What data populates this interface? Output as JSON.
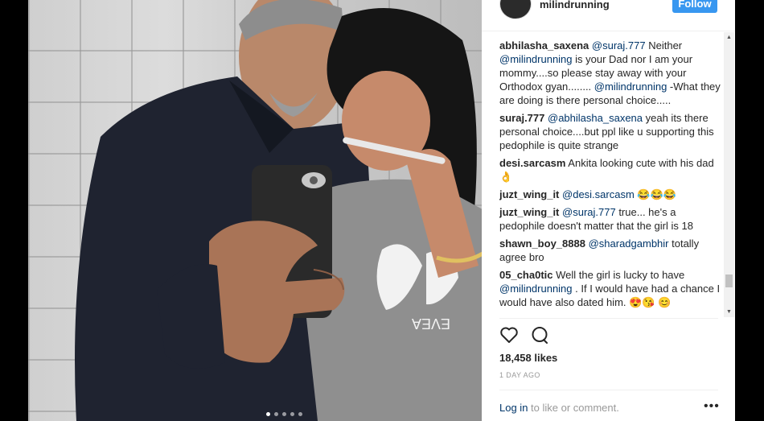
{
  "header": {
    "username": "milindrunning",
    "follow_label": "Follow"
  },
  "comments": [
    {
      "user": "abhilasha_saxena",
      "segments": [
        {
          "t": "mention",
          "v": "@suraj.777"
        },
        {
          "t": "text",
          "v": " Neither "
        },
        {
          "t": "mention",
          "v": "@milindrunning"
        },
        {
          "t": "text",
          "v": " is your Dad nor I am your mommy....so please stay away with your Orthodox gyan........ "
        },
        {
          "t": "mention",
          "v": "@milindrunning"
        },
        {
          "t": "text",
          "v": " -What they are doing is there personal choice....."
        }
      ]
    },
    {
      "user": "suraj.777",
      "segments": [
        {
          "t": "mention",
          "v": "@abhilasha_saxena"
        },
        {
          "t": "text",
          "v": " yeah its there personal choice....but ppl like u supporting this pedophile is quite strange"
        }
      ]
    },
    {
      "user": "desi.sarcasm",
      "segments": [
        {
          "t": "text",
          "v": " Ankita looking cute with his dad 👌"
        }
      ]
    },
    {
      "user": "juzt_wing_it",
      "segments": [
        {
          "t": "mention",
          "v": "@desi.sarcasm"
        },
        {
          "t": "text",
          "v": " 😂😂😂"
        }
      ]
    },
    {
      "user": "juzt_wing_it",
      "segments": [
        {
          "t": "mention",
          "v": "@suraj.777"
        },
        {
          "t": "text",
          "v": " true... he's a pedophile doesn't matter that the girl is 18"
        }
      ]
    },
    {
      "user": "shawn_boy_8888",
      "segments": [
        {
          "t": "mention",
          "v": "@sharadgambhir"
        },
        {
          "t": "text",
          "v": " totally agree bro"
        }
      ]
    },
    {
      "user": "05_cha0tic",
      "segments": [
        {
          "t": "text",
          "v": " Well the girl is lucky to have "
        },
        {
          "t": "mention",
          "v": "@milindrunning"
        },
        {
          "t": "text",
          "v": " . If I would have had a chance I would have also dated him. 😍😘 😊"
        }
      ]
    }
  ],
  "stats": {
    "likes": "18,458 likes",
    "time": "1 DAY AGO"
  },
  "footer": {
    "login_link": "Log in",
    "login_rest": " to like or comment.",
    "more": "•••"
  },
  "icons": {
    "like": "heart-icon",
    "comment": "comment-bubble-icon",
    "more": "more-options-icon"
  },
  "carousel": {
    "count": 5,
    "active": 0
  },
  "colors": {
    "follow_button": "#3897f0",
    "link": "#003569",
    "muted": "#999999"
  }
}
